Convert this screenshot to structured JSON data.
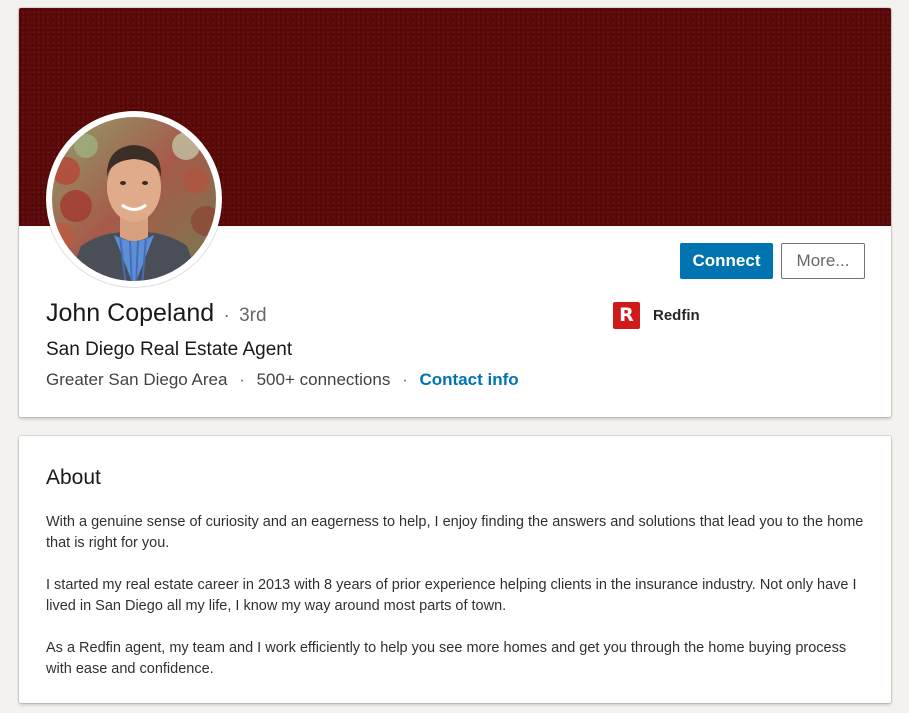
{
  "profile": {
    "name": "John Copeland",
    "separator": "·",
    "degree": "3rd",
    "headline": "San Diego Real Estate Agent",
    "location": "Greater San Diego Area",
    "connections": "500+ connections",
    "contact_info": "Contact info",
    "banner_color": "#5e0909",
    "actions": {
      "connect_label": "Connect",
      "more_label": "More..."
    },
    "company": {
      "name": "Redfin",
      "logo_letter": "R",
      "logo_color": "#d01a1a"
    }
  },
  "about": {
    "title": "About",
    "paragraphs": [
      "With a genuine sense of curiosity and an eagerness to help, I enjoy finding the answers and solutions that lead you to the home that is right for you.",
      "I started my real estate career in 2013 with 8 years of prior experience helping clients in the insurance industry. Not only have I lived in San Diego all my life, I know my way around most parts of town.",
      "As a Redfin agent, my team and I work efficiently to help you see more homes and get you through the home buying process with ease and confidence."
    ]
  },
  "colors": {
    "accent": "#0073b1",
    "page_background": "#f3f2ef"
  }
}
